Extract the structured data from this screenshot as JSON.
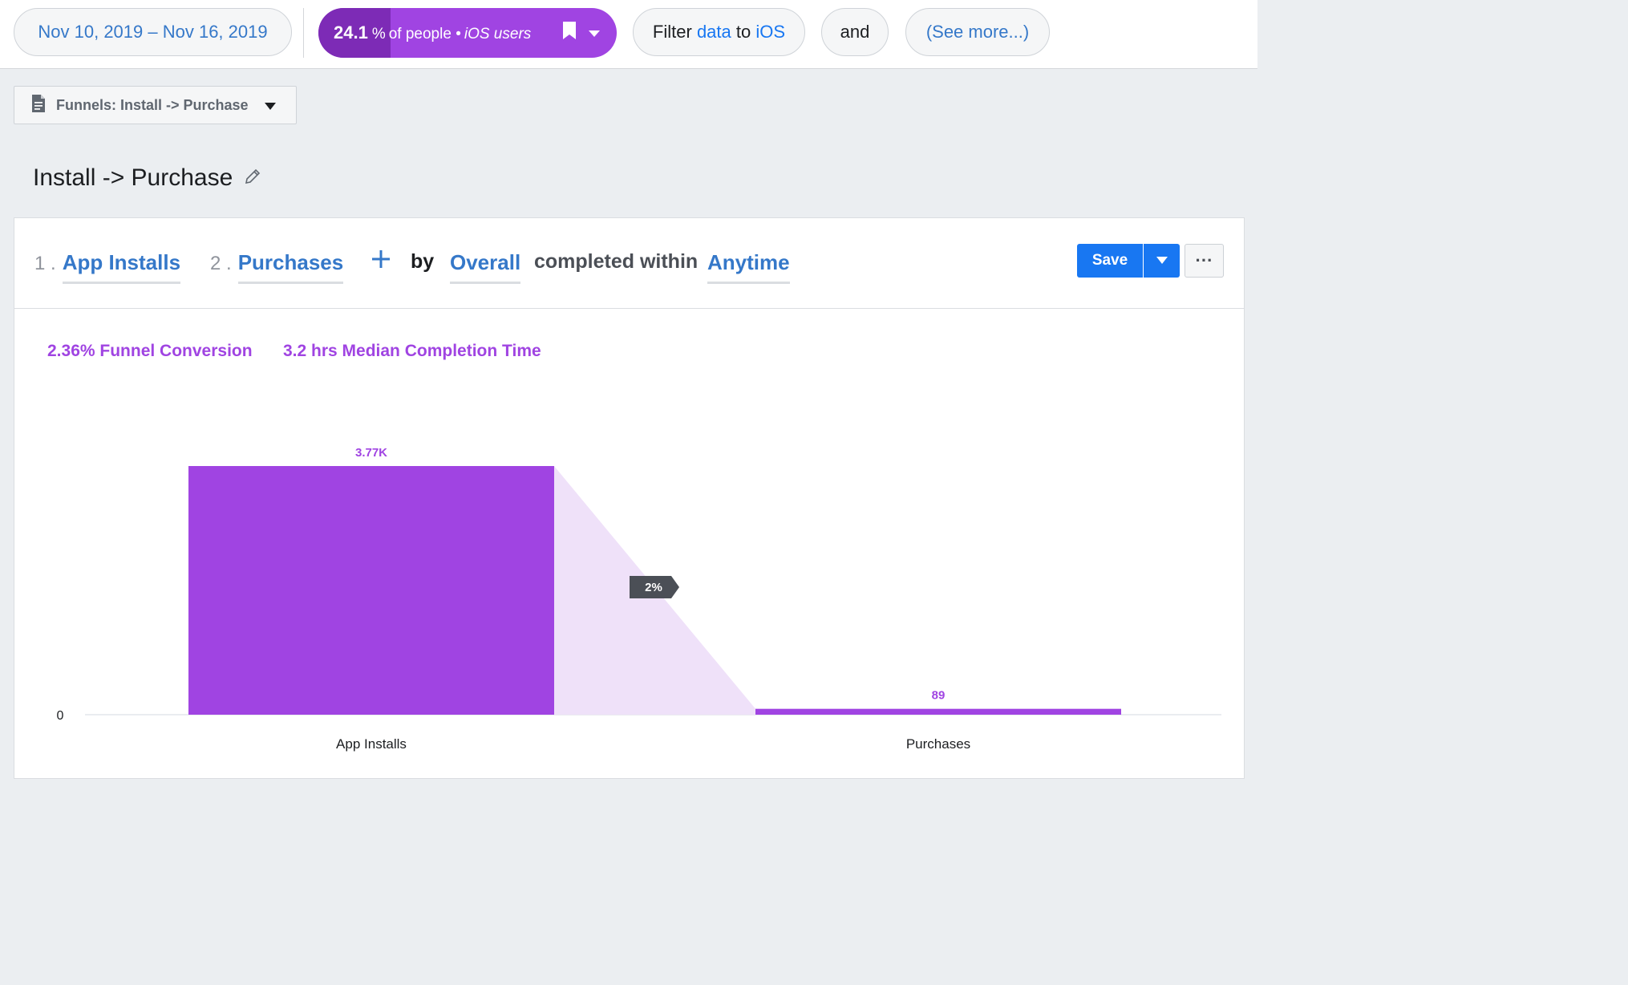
{
  "topbar": {
    "date_range": "Nov 10, 2019 – Nov 16, 2019",
    "segment": {
      "percent": "24.1",
      "percent_value": 24.1,
      "percent_suffix": "%",
      "text": "of people •",
      "name": "iOS users"
    },
    "filter": {
      "prefix": "Filter",
      "link1": "data",
      "middle": "to",
      "link2": "iOS"
    },
    "and_label": "and",
    "see_more": "(See more...)"
  },
  "report_selector": {
    "label": "Funnels: Install -> Purchase"
  },
  "page_title": "Install -> Purchase",
  "query": {
    "steps": [
      {
        "num": "1 .",
        "name": "App Installs"
      },
      {
        "num": "2 .",
        "name": "Purchases"
      }
    ],
    "by_label": "by",
    "breakdown": "Overall",
    "completed_label": "completed within",
    "window": "Anytime"
  },
  "actions": {
    "save": "Save",
    "more": "···"
  },
  "summary": {
    "conversion": "2.36% Funnel Conversion",
    "median_time": "3.2 hrs Median Completion Time"
  },
  "colors": {
    "accent": "#a044e2",
    "accent_dark": "#7d2bb6",
    "link": "#1877f2",
    "connector": "#efe1f9"
  },
  "chart_data": {
    "type": "bar",
    "categories": [
      "App Installs",
      "Purchases"
    ],
    "values": [
      3770,
      89
    ],
    "value_labels": [
      "3.77K",
      "89"
    ],
    "conversion_labels": [
      "2%"
    ],
    "y_tick_labels": [
      "0"
    ],
    "ylim": [
      0,
      3770
    ]
  }
}
